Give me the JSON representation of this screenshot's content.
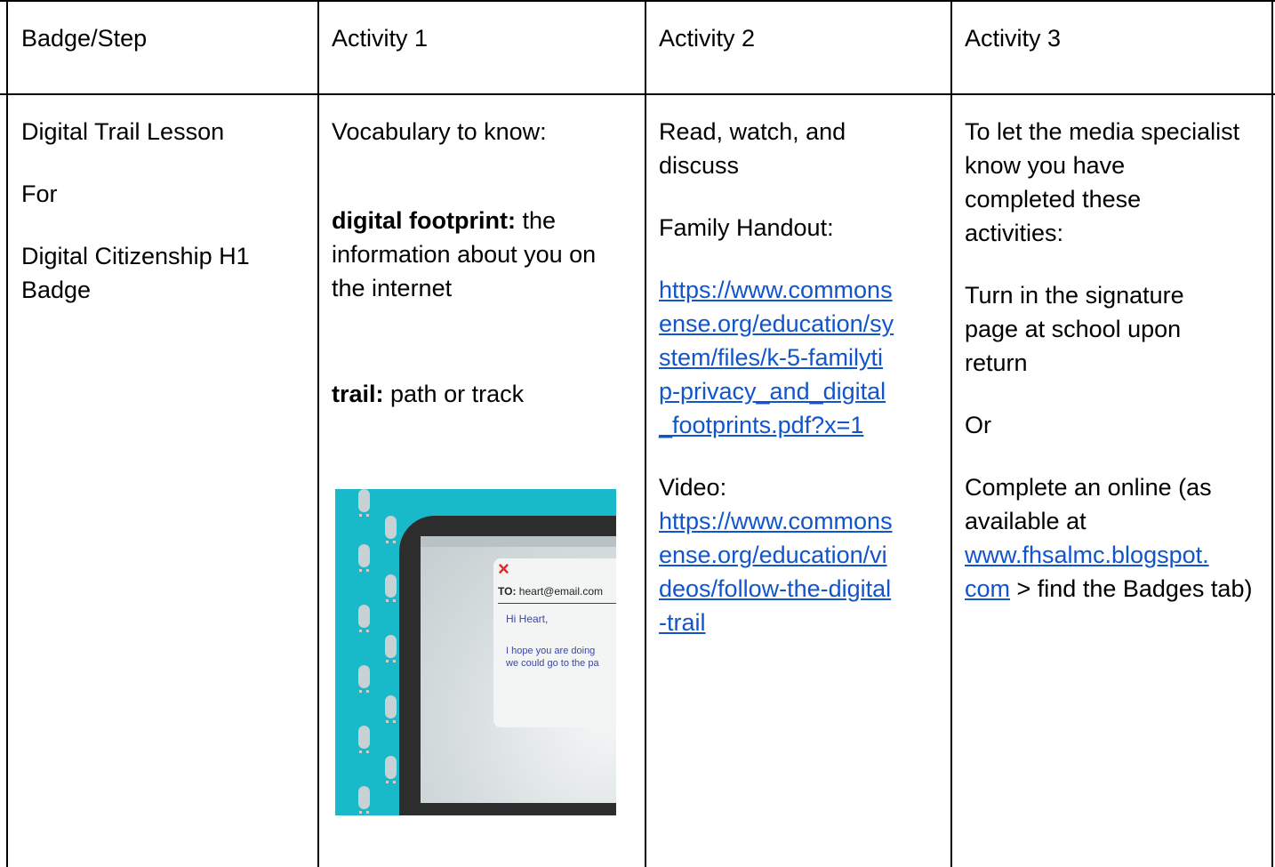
{
  "header": {
    "col1": "Badge/Step",
    "col2": "Activity 1",
    "col3": "Activity 2",
    "col4": "Activity 3"
  },
  "row": {
    "badge": {
      "line1": "Digital Trail Lesson",
      "line2": "For",
      "line3": "Digital Citizenship H1 Badge"
    },
    "activity1": {
      "intro": "Vocabulary to know:",
      "term1": "digital footprint:",
      "def1": " the information about you on the internet",
      "term2": "trail:",
      "def2": " path or track",
      "image": {
        "to_label": "TO:",
        "to_value": "heart@email.com",
        "greeting": "Hi Heart,",
        "body_line1": "I hope you are doing",
        "body_line2": "we could go to the pa",
        "close": "×"
      }
    },
    "activity2": {
      "intro": "Read, watch, and discuss",
      "handout_label": "Family Handout:",
      "handout_link_lines": [
        "https://www.commons",
        "ense.org/education/sy",
        "stem/files/k-5-familyti",
        "p-privacy_and_digital",
        "_footprints.pdf?x=1"
      ],
      "video_label": "Video:",
      "video_link_lines": [
        "https://www.commons",
        "ense.org/education/vi",
        "deos/follow-the-digital",
        "-trail"
      ]
    },
    "activity3": {
      "intro": "To let the media specialist know you have completed these activities:",
      "option1": "Turn in the signature page at school upon return",
      "or": "Or",
      "option2_pre": "Complete an online (as available at ",
      "option2_link": "www.fhsalmc.blogspot.com",
      "option2_link_lines": [
        "www.fhsalmc.blogspot.",
        "com"
      ],
      "option2_post": " > find the Badges tab)"
    }
  },
  "colors": {
    "link": "#1155cc",
    "border": "#000000",
    "illustration_bg": "#18b9c9"
  }
}
